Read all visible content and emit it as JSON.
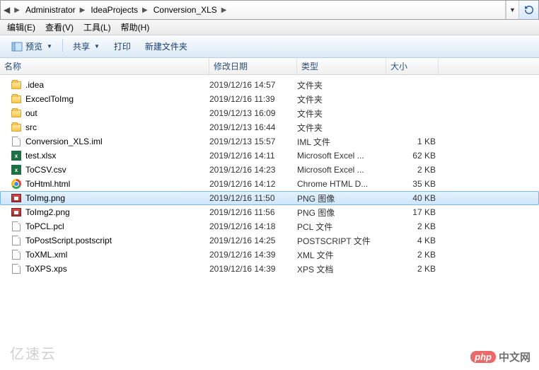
{
  "breadcrumbs": [
    "Administrator",
    "IdeaProjects",
    "Conversion_XLS"
  ],
  "menu": {
    "edit": "编辑(E)",
    "view": "查看(V)",
    "tools": "工具(L)",
    "help": "帮助(H)"
  },
  "toolbar": {
    "preview": "预览",
    "share": "共享",
    "print": "打印",
    "new_folder": "新建文件夹"
  },
  "columns": {
    "name": "名称",
    "date": "修改日期",
    "type": "类型",
    "size": "大小"
  },
  "files": [
    {
      "icon": "folder",
      "name": ".idea",
      "date": "2019/12/16 14:57",
      "type": "文件夹",
      "size": ""
    },
    {
      "icon": "folder",
      "name": "ExceclToImg",
      "date": "2019/12/16 11:39",
      "type": "文件夹",
      "size": ""
    },
    {
      "icon": "folder",
      "name": "out",
      "date": "2019/12/13 16:09",
      "type": "文件夹",
      "size": ""
    },
    {
      "icon": "folder",
      "name": "src",
      "date": "2019/12/13 16:44",
      "type": "文件夹",
      "size": ""
    },
    {
      "icon": "file",
      "name": "Conversion_XLS.iml",
      "date": "2019/12/13 15:57",
      "type": "IML 文件",
      "size": "1 KB"
    },
    {
      "icon": "excel",
      "name": "test.xlsx",
      "date": "2019/12/16 14:11",
      "type": "Microsoft Excel ...",
      "size": "62 KB"
    },
    {
      "icon": "excel",
      "name": "ToCSV.csv",
      "date": "2019/12/16 14:23",
      "type": "Microsoft Excel ...",
      "size": "2 KB"
    },
    {
      "icon": "chrome",
      "name": "ToHtml.html",
      "date": "2019/12/16 14:12",
      "type": "Chrome HTML D...",
      "size": "35 KB"
    },
    {
      "icon": "img",
      "name": "ToImg.png",
      "date": "2019/12/16 11:50",
      "type": "PNG 图像",
      "size": "40 KB",
      "selected": true
    },
    {
      "icon": "img",
      "name": "ToImg2.png",
      "date": "2019/12/16 11:56",
      "type": "PNG 图像",
      "size": "17 KB"
    },
    {
      "icon": "file",
      "name": "ToPCL.pcl",
      "date": "2019/12/16 14:18",
      "type": "PCL 文件",
      "size": "2 KB"
    },
    {
      "icon": "file",
      "name": "ToPostScript.postscript",
      "date": "2019/12/16 14:25",
      "type": "POSTSCRIPT 文件",
      "size": "4 KB"
    },
    {
      "icon": "file",
      "name": "ToXML.xml",
      "date": "2019/12/16 14:39",
      "type": "XML 文件",
      "size": "2 KB"
    },
    {
      "icon": "file",
      "name": "ToXPS.xps",
      "date": "2019/12/16 14:39",
      "type": "XPS 文档",
      "size": "2 KB"
    }
  ],
  "watermark": {
    "pill": "php",
    "text": "中文网",
    "left": "亿速云"
  }
}
